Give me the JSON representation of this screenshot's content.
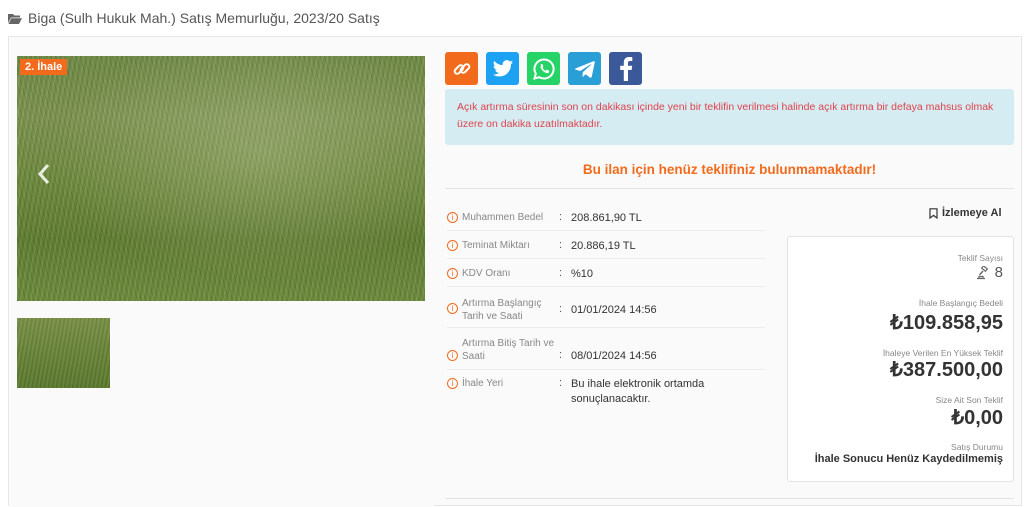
{
  "header": {
    "title": "Biga (Sulh Hukuk Mah.) Satış Memurluğu, 2023/20 Satış",
    "icon": "folder-open-icon"
  },
  "gallery": {
    "badge": "2. İhale",
    "prev_icon": "chevron-left-icon",
    "next_icon": "chevron-right-icon"
  },
  "share": {
    "items": [
      {
        "icon": "link-icon",
        "color": "#f26b1d"
      },
      {
        "icon": "twitter-icon",
        "color": "#1da1f2"
      },
      {
        "icon": "whatsapp-icon",
        "color": "#25d366"
      },
      {
        "icon": "telegram-icon",
        "color": "#2a9fd6"
      },
      {
        "icon": "facebook-icon",
        "color": "#3b5998"
      }
    ]
  },
  "alert": {
    "text": "Açık artırma süresinin son on dakikası içinde yeni bir teklifin verilmesi halinde açık artırma bir defaya mahsus olmak üzere on dakika uzatılmaktadır."
  },
  "notice": "Bu ilan için henüz teklifiniz bulunmamaktadır!",
  "details": [
    {
      "label": "Muhammen Bedel",
      "value": "208.861,90 TL"
    },
    {
      "label": "Teminat Miktarı",
      "value": "20.886,19 TL"
    },
    {
      "label": "KDV Oranı",
      "value": "%10"
    },
    {
      "label": "Artırma Başlangıç Tarih ve Saati",
      "value": "01/01/2024 14:56"
    },
    {
      "label": "Artırma Bitiş Tarih ve Saati",
      "value": "08/01/2024 14:56"
    },
    {
      "label": "İhale Yeri",
      "value": "Bu ihale elektronik ortamda sonuçlanacaktır."
    }
  ],
  "watch": {
    "label": "İzlemeye Al"
  },
  "summary": {
    "bid_count_label": "Teklif Sayısı",
    "bid_count": "8",
    "start_price_label": "İhale Başlangıç Bedeli",
    "start_price": "₺109.858,95",
    "highest_bid_label": "İhaleye Verilen En Yüksek Teklif",
    "highest_bid": "₺387.500,00",
    "min_bid_label": "Size Ait Son Teklif",
    "min_bid": "₺0,00",
    "status_label": "Satış Durumu",
    "status": "İhale Sonucu Henüz Kaydedilmemiş"
  }
}
